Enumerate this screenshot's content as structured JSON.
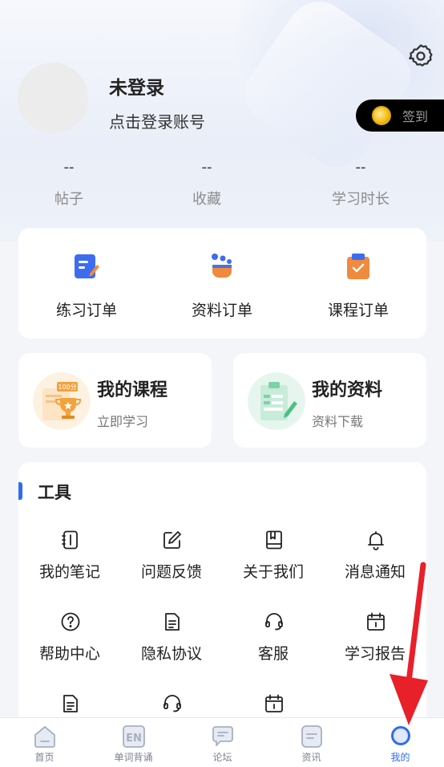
{
  "profile": {
    "name": "未登录",
    "login_hint": "点击登录账号",
    "checkin_label": "签到"
  },
  "stats": [
    {
      "value": "--",
      "label": "帖子"
    },
    {
      "value": "--",
      "label": "收藏"
    },
    {
      "value": "--",
      "label": "学习时长"
    }
  ],
  "orders": [
    {
      "label": "练习订单",
      "icon": "practice-order-icon"
    },
    {
      "label": "资料订单",
      "icon": "material-order-icon"
    },
    {
      "label": "课程订单",
      "icon": "course-order-icon"
    }
  ],
  "promos": {
    "course": {
      "title": "我的课程",
      "subtitle": "立即学习",
      "badge": "100分"
    },
    "data": {
      "title": "我的资料",
      "subtitle": "资料下载"
    }
  },
  "tools": {
    "title": "工具",
    "items": [
      {
        "label": "我的笔记",
        "icon": "notebook-icon"
      },
      {
        "label": "问题反馈",
        "icon": "edit-feedback-icon"
      },
      {
        "label": "关于我们",
        "icon": "book-icon"
      },
      {
        "label": "消息通知",
        "icon": "bell-icon"
      },
      {
        "label": "帮助中心",
        "icon": "help-icon"
      },
      {
        "label": "隐私协议",
        "icon": "document-icon"
      },
      {
        "label": "客服",
        "icon": "headset-icon"
      },
      {
        "label": "学习报告",
        "icon": "calendar-icon"
      },
      {
        "label": "",
        "icon": "document-icon"
      },
      {
        "label": "",
        "icon": "headset-icon"
      },
      {
        "label": "",
        "icon": "calendar-icon"
      }
    ]
  },
  "tabbar": [
    {
      "label": "首页",
      "icon": "home-icon",
      "active": false
    },
    {
      "label": "单词背诵",
      "icon": "en-words-icon",
      "active": false
    },
    {
      "label": "论坛",
      "icon": "forum-icon",
      "active": false
    },
    {
      "label": "资讯",
      "icon": "news-icon",
      "active": false
    },
    {
      "label": "我的",
      "icon": "profile-icon",
      "active": true
    }
  ],
  "colors": {
    "accent": "#2f6bf2",
    "annotation_arrow": "#e8202a"
  }
}
